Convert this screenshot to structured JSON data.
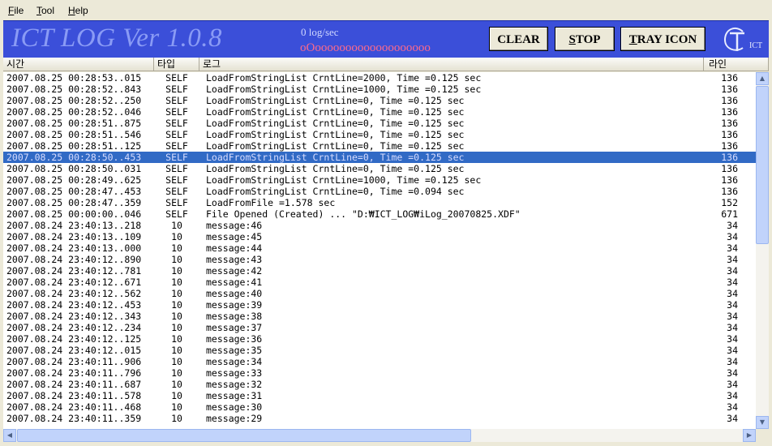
{
  "menu": [
    {
      "key": "F",
      "rest": "ile"
    },
    {
      "key": "T",
      "rest": "ool"
    },
    {
      "key": "H",
      "rest": "elp"
    }
  ],
  "banner": {
    "title": "ICT LOG Ver 1.0.8",
    "rate": "0 log/sec",
    "meter": "oOooooooooooooooooooo",
    "logo_text": "ICT"
  },
  "buttons": {
    "clear": "CLEAR",
    "stop_key": "S",
    "stop_rest": "TOP",
    "tray_key": "T",
    "tray_rest": "RAY ICON"
  },
  "columns": {
    "time": "시간",
    "type": "타입",
    "log": "로그",
    "line": "라인"
  },
  "rows": [
    {
      "time": "2007.08.25 00:28:53..015",
      "type": "SELF",
      "msg": "LoadFromStringList CrntLine=2000, Time =0.125 sec",
      "line": "136"
    },
    {
      "time": "2007.08.25 00:28:52..843",
      "type": "SELF",
      "msg": "LoadFromStringList CrntLine=1000, Time =0.125 sec",
      "line": "136"
    },
    {
      "time": "2007.08.25 00:28:52..250",
      "type": "SELF",
      "msg": "LoadFromStringList CrntLine=0, Time =0.125 sec",
      "line": "136"
    },
    {
      "time": "2007.08.25 00:28:52..046",
      "type": "SELF",
      "msg": "LoadFromStringList CrntLine=0, Time =0.125 sec",
      "line": "136"
    },
    {
      "time": "2007.08.25 00:28:51..875",
      "type": "SELF",
      "msg": "LoadFromStringList CrntLine=0, Time =0.125 sec",
      "line": "136"
    },
    {
      "time": "2007.08.25 00:28:51..546",
      "type": "SELF",
      "msg": "LoadFromStringList CrntLine=0, Time =0.125 sec",
      "line": "136"
    },
    {
      "time": "2007.08.25 00:28:51..125",
      "type": "SELF",
      "msg": "LoadFromStringList CrntLine=0, Time =0.125 sec",
      "line": "136"
    },
    {
      "time": "2007.08.25 00:28:50..453",
      "type": "SELF",
      "msg": "LoadFromStringList CrntLine=0, Time =0.125 sec",
      "line": "136",
      "selected": true
    },
    {
      "time": "2007.08.25 00:28:50..031",
      "type": "SELF",
      "msg": "LoadFromStringList CrntLine=0, Time =0.125 sec",
      "line": "136"
    },
    {
      "time": "2007.08.25 00:28:49..625",
      "type": "SELF",
      "msg": "LoadFromStringList CrntLine=1000, Time =0.125 sec",
      "line": "136"
    },
    {
      "time": "2007.08.25 00:28:47..453",
      "type": "SELF",
      "msg": "LoadFromStringList CrntLine=0, Time =0.094 sec",
      "line": "136"
    },
    {
      "time": "2007.08.25 00:28:47..359",
      "type": "SELF",
      "msg": "LoadFromFile =1.578 sec",
      "line": "152"
    },
    {
      "time": "2007.08.25 00:00:00..046",
      "type": "SELF",
      "msg": "File Opened (Created) ... \"D:₩ICT_LOG₩iLog_20070825.XDF\"",
      "line": "671"
    },
    {
      "time": "2007.08.24 23:40:13..218",
      "type": "10",
      "msg": "message:46",
      "line": "34"
    },
    {
      "time": "2007.08.24 23:40:13..109",
      "type": "10",
      "msg": "message:45",
      "line": "34"
    },
    {
      "time": "2007.08.24 23:40:13..000",
      "type": "10",
      "msg": "message:44",
      "line": "34"
    },
    {
      "time": "2007.08.24 23:40:12..890",
      "type": "10",
      "msg": "message:43",
      "line": "34"
    },
    {
      "time": "2007.08.24 23:40:12..781",
      "type": "10",
      "msg": "message:42",
      "line": "34"
    },
    {
      "time": "2007.08.24 23:40:12..671",
      "type": "10",
      "msg": "message:41",
      "line": "34"
    },
    {
      "time": "2007.08.24 23:40:12..562",
      "type": "10",
      "msg": "message:40",
      "line": "34"
    },
    {
      "time": "2007.08.24 23:40:12..453",
      "type": "10",
      "msg": "message:39",
      "line": "34"
    },
    {
      "time": "2007.08.24 23:40:12..343",
      "type": "10",
      "msg": "message:38",
      "line": "34"
    },
    {
      "time": "2007.08.24 23:40:12..234",
      "type": "10",
      "msg": "message:37",
      "line": "34"
    },
    {
      "time": "2007.08.24 23:40:12..125",
      "type": "10",
      "msg": "message:36",
      "line": "34"
    },
    {
      "time": "2007.08.24 23:40:12..015",
      "type": "10",
      "msg": "message:35",
      "line": "34"
    },
    {
      "time": "2007.08.24 23:40:11..906",
      "type": "10",
      "msg": "message:34",
      "line": "34"
    },
    {
      "time": "2007.08.24 23:40:11..796",
      "type": "10",
      "msg": "message:33",
      "line": "34"
    },
    {
      "time": "2007.08.24 23:40:11..687",
      "type": "10",
      "msg": "message:32",
      "line": "34"
    },
    {
      "time": "2007.08.24 23:40:11..578",
      "type": "10",
      "msg": "message:31",
      "line": "34"
    },
    {
      "time": "2007.08.24 23:40:11..468",
      "type": "10",
      "msg": "message:30",
      "line": "34"
    },
    {
      "time": "2007.08.24 23:40:11..359",
      "type": "10",
      "msg": "message:29",
      "line": "34"
    }
  ],
  "icons": {
    "scroll_up": "scroll-up-icon",
    "scroll_down": "scroll-down-icon",
    "scroll_left": "scroll-left-icon",
    "scroll_right": "scroll-right-icon"
  },
  "colors": {
    "banner": "#3b4fd9",
    "selection": "#316ac5",
    "meter": "#ff6a8a"
  }
}
